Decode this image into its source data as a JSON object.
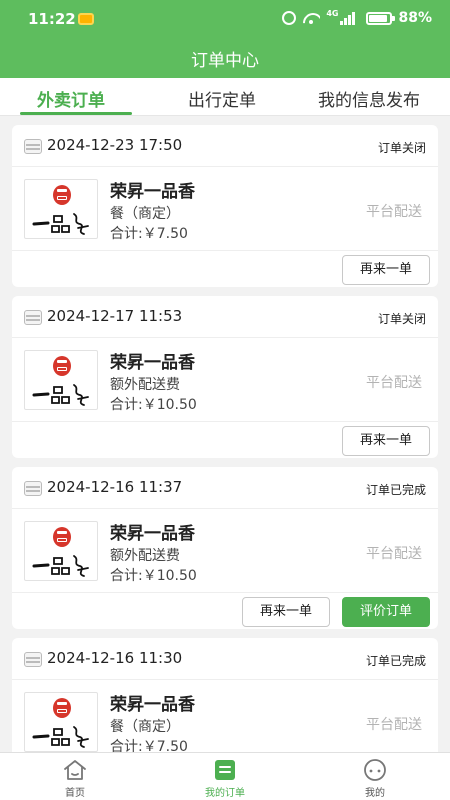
{
  "status_bar": {
    "time": "11:22",
    "battery": "88%",
    "network": "4G"
  },
  "header": {
    "title": "订单中心"
  },
  "tabs": [
    {
      "label": "外卖订单",
      "active": true
    },
    {
      "label": "出行定单",
      "active": false
    },
    {
      "label": "我的信息发布",
      "active": false
    }
  ],
  "orders": [
    {
      "time": "2024-12-23 17:50",
      "status": "订单关闭",
      "store": "荣昇一品香",
      "item": "餐（商定）",
      "total": "合计:￥7.50",
      "delivery": "平台配送",
      "reorder_label": "再来一单",
      "review_label": ""
    },
    {
      "time": "2024-12-17 11:53",
      "status": "订单关闭",
      "store": "荣昇一品香",
      "item": "额外配送费",
      "total": "合计:￥10.50",
      "delivery": "平台配送",
      "reorder_label": "再来一单",
      "review_label": ""
    },
    {
      "time": "2024-12-16 11:37",
      "status": "订单已完成",
      "store": "荣昇一品香",
      "item": "额外配送费",
      "total": "合计:￥10.50",
      "delivery": "平台配送",
      "reorder_label": "再来一单",
      "review_label": "评价订单"
    },
    {
      "time": "2024-12-16 11:30",
      "status": "订单已完成",
      "store": "荣昇一品香",
      "item": "餐（商定）",
      "total": "合计:￥7.50",
      "delivery": "平台配送",
      "reorder_label": "",
      "review_label": ""
    }
  ],
  "bottom_nav": [
    {
      "label": "首页",
      "icon": "home-icon",
      "active": false
    },
    {
      "label": "我的订单",
      "icon": "order-list-icon",
      "active": true
    },
    {
      "label": "我的",
      "icon": "profile-icon",
      "active": false
    }
  ],
  "colors": {
    "brand_green": "#5ebd5e",
    "accent_green": "#4caf50",
    "seal_red": "#d6362b"
  }
}
